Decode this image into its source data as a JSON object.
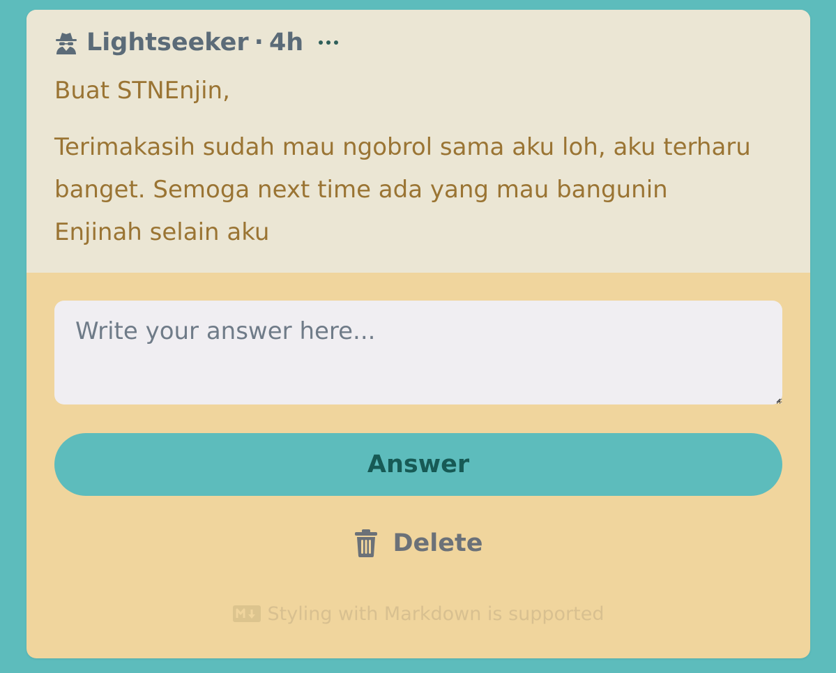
{
  "question": {
    "author": "Lightseeker",
    "separator": "·",
    "time_ago": "4h",
    "author_icon": "incognito-spy-icon",
    "menu_icon": "ellipsis-icon",
    "greeting": "Buat STNEnjin,",
    "message": "Terimakasih sudah mau ngobrol sama aku loh, aku terharu banget. Semoga next time ada yang mau bangunin Enjinah selain aku"
  },
  "answer_form": {
    "placeholder": "Write your answer here...",
    "value": "",
    "submit_label": "Answer",
    "delete_label": "Delete",
    "delete_icon": "trash-icon",
    "markdown_note": "Styling with Markdown is supported",
    "markdown_icon": "markdown-icon"
  },
  "colors": {
    "page_background": "#5dbcbc",
    "question_background": "#ebe6d4",
    "answer_background": "#f0d59d",
    "accent": "#5dbcbc",
    "question_text": "#9a7433",
    "author_text": "#5b6b78"
  }
}
